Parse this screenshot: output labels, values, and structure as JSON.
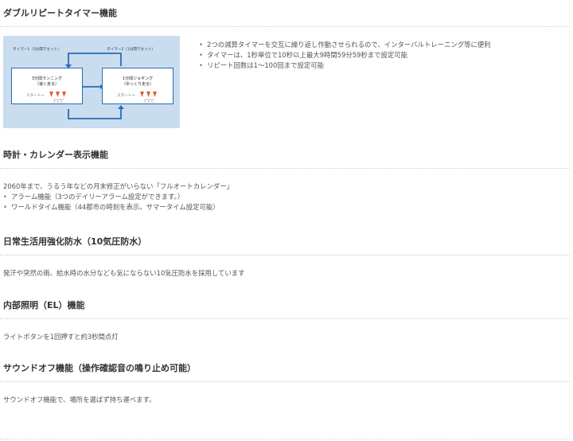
{
  "sections": {
    "double_repeat_timer": {
      "title": "ダブルリピートタイマー機能",
      "bullets": [
        "2つの減算タイマーを交互に繰り返し作動させられるので、インターバルトレーニング等に便利",
        "タイマーは、1秒単位で10秒以上最大9時間59分59秒まで設定可能",
        "リピート回数は1〜100回まで設定可能"
      ],
      "diagram": {
        "timer1_label": "タイマー1（3分間でセット）",
        "timer2_label": "タイマー2（1分間でセット）",
        "box1_line1": "3分間ランニング",
        "box1_line2": "（速く走る）",
        "box2_line1": "1分間ジョギング",
        "box2_line2": "（ゆっくり走る）",
        "start_label": "スタート→",
        "beep_label": "ピピピ",
        "accent_color": "#2a6cb8",
        "background_color": "#c9ddef"
      }
    },
    "clock_calendar": {
      "title": "時計・カレンダー表示機能",
      "intro": "2060年まで、うるう年などの月末修正がいらない「フルオートカレンダー」",
      "bullets": [
        "アラーム機能（3つのデイリーアラーム設定ができます。）",
        "ワールドタイム機能（44都市の時刻を表示。サマータイム設定可能）"
      ]
    },
    "water_resist": {
      "title": "日常生活用強化防水（10気圧防水）",
      "text": "発汗や突然の雨、給水時の水分なども気にならない10気圧防水を採用しています"
    },
    "el_light": {
      "title": "内部照明（EL）機能",
      "text": "ライトボタンを1回押すと約3秒間点灯"
    },
    "sound_off": {
      "title": "サウンドオフ機能（操作確認音の鳴り止め可能）",
      "text": "サウンドオフ機能で、場所を選ばず持ち運べます。"
    }
  }
}
